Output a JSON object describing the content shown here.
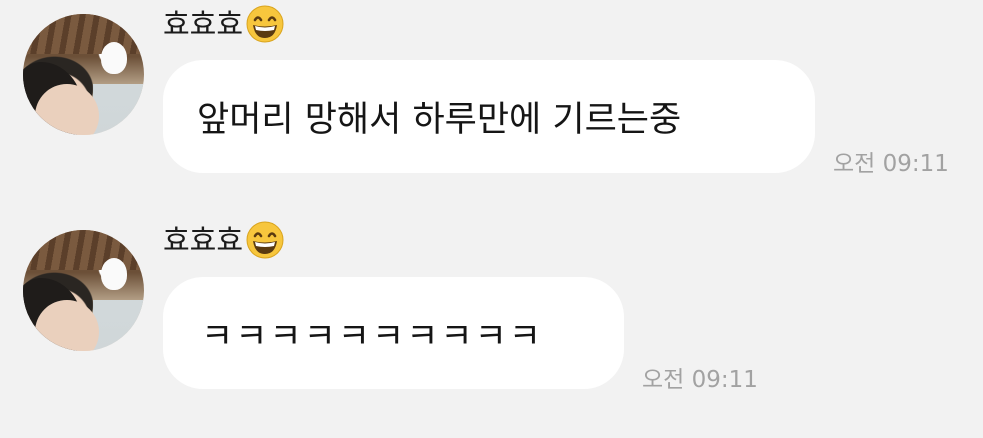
{
  "messages": [
    {
      "sender": "효효효",
      "sender_emoji": "grinning-face-with-smiling-eyes",
      "text": "앞머리 망해서 하루만에 기르는중",
      "time": "오전 09:11"
    },
    {
      "sender": "효효효",
      "sender_emoji": "grinning-face-with-smiling-eyes",
      "text": "ㅋㅋㅋㅋㅋㅋㅋㅋㅋㅋ",
      "time": "오전 09:11"
    }
  ],
  "colors": {
    "background": "#f2f2f2",
    "bubble": "#ffffff",
    "time_text": "#a2a2a2"
  }
}
